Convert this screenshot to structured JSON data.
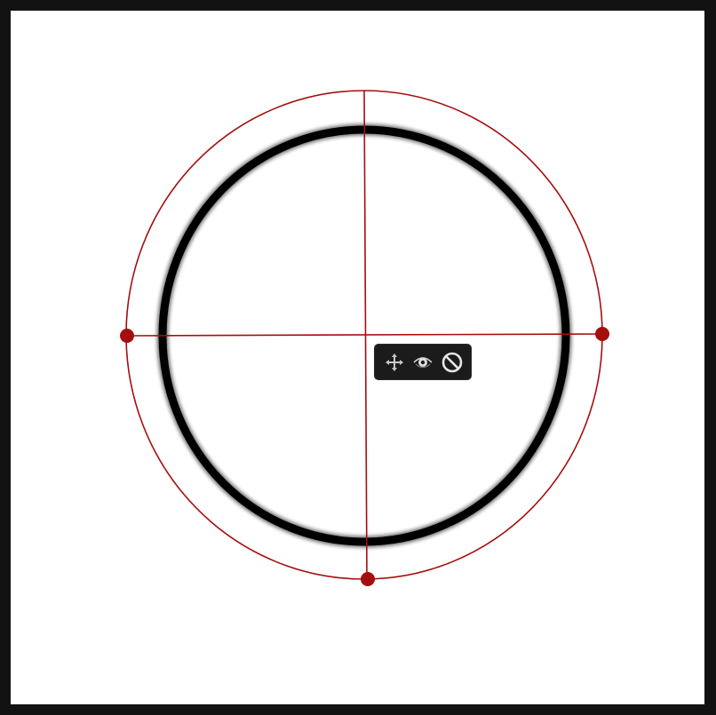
{
  "canvas": {
    "background": "#ffffff",
    "frame_color": "#121212"
  },
  "guide": {
    "color": "#a50e0e",
    "handles": [
      "left-handle",
      "right-handle",
      "bottom-handle"
    ]
  },
  "stroke": {
    "color": "#000000"
  },
  "toolbar": {
    "tools": [
      {
        "icon": "move-arrows-icon",
        "tooltip": ""
      },
      {
        "icon": "eye-icon",
        "tooltip": ""
      },
      {
        "icon": "prohibit-icon",
        "tooltip": ""
      }
    ]
  }
}
